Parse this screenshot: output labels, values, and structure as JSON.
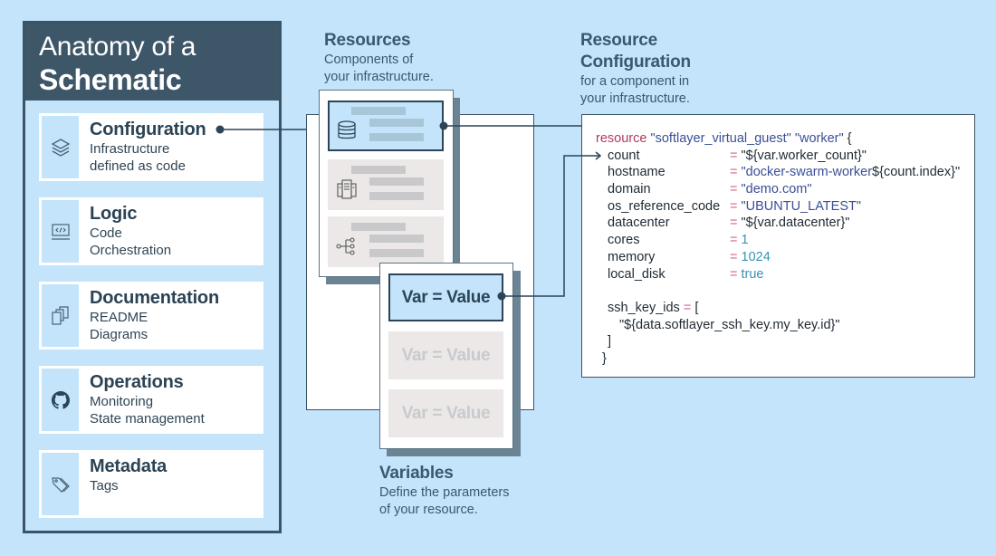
{
  "panel": {
    "title_line1": "Anatomy of a",
    "title_line2": "Schematic",
    "cards": [
      {
        "icon": "layers-icon",
        "title": "Configuration",
        "lines": [
          "Infrastructure",
          "defined as code"
        ]
      },
      {
        "icon": "code-icon",
        "title": "Logic",
        "lines": [
          "Code",
          "Orchestration"
        ]
      },
      {
        "icon": "documents-icon",
        "title": "Documentation",
        "lines": [
          "README",
          "Diagrams"
        ]
      },
      {
        "icon": "github-icon",
        "title": "Operations",
        "lines": [
          "Monitoring",
          "State management"
        ]
      },
      {
        "icon": "tags-icon",
        "title": "Metadata",
        "lines": [
          "Tags"
        ]
      }
    ]
  },
  "resources": {
    "title": "Resources",
    "desc_line1": "Components of",
    "desc_line2": "your infrastructure.",
    "items": [
      {
        "icon": "database-icon",
        "active": true
      },
      {
        "icon": "server-icon",
        "active": false
      },
      {
        "icon": "network-tree-icon",
        "active": false
      }
    ]
  },
  "variables": {
    "title": "Variables",
    "desc_line1": "Define the parameters",
    "desc_line2": "of your resource.",
    "items": [
      {
        "label": "Var = Value",
        "active": true
      },
      {
        "label": "Var = Value",
        "active": false
      },
      {
        "label": "Var = Value",
        "active": false
      }
    ]
  },
  "resource_config": {
    "title_line1": "Resource",
    "title_line2": "Configuration",
    "desc_line1": "for a component in",
    "desc_line2": "your infrastructure."
  },
  "code": {
    "header": [
      {
        "text": "resource",
        "kind": "keyword"
      },
      {
        "text": " \"softlayer_virtual_guest\" \"worker\"",
        "kind": "string"
      },
      {
        "text": " {",
        "kind": "plain"
      }
    ],
    "attributes": [
      {
        "key": "count",
        "value": [
          {
            "text": "\"${var.worker_count}\"",
            "kind": "plain"
          }
        ]
      },
      {
        "key": "hostname",
        "value": [
          {
            "text": "\"docker-swarm-worker",
            "kind": "string"
          },
          {
            "text": "${count.index}\"",
            "kind": "plain"
          }
        ]
      },
      {
        "key": "domain",
        "value": [
          {
            "text": "\"demo.com\"",
            "kind": "string"
          }
        ]
      },
      {
        "key": "os_reference_code",
        "value": [
          {
            "text": "\"UBUNTU_LATEST\"",
            "kind": "string"
          }
        ]
      },
      {
        "key": "datacenter",
        "value": [
          {
            "text": "\"${var.datacenter}\"",
            "kind": "plain"
          }
        ]
      },
      {
        "key": "cores",
        "value": [
          {
            "text": "1",
            "kind": "number"
          }
        ]
      },
      {
        "key": "memory",
        "value": [
          {
            "text": "1024",
            "kind": "number"
          }
        ]
      },
      {
        "key": "local_disk",
        "value": [
          {
            "text": "true",
            "kind": "number"
          }
        ]
      }
    ],
    "operator": "=",
    "list_block": {
      "key": "ssh_key_ids",
      "open": "[",
      "item": "\"${data.softlayer_ssh_key.my_key.id}\"",
      "close": "]"
    },
    "end": "}"
  },
  "colors": {
    "background": "#c3e4fb",
    "slate": "#3b5467",
    "card": "#ffffff",
    "inactive": "#ebe8e7",
    "keyword": "#b23a5e",
    "string": "#3a4f97",
    "operator": "#d0668f",
    "number": "#3b93b5"
  }
}
